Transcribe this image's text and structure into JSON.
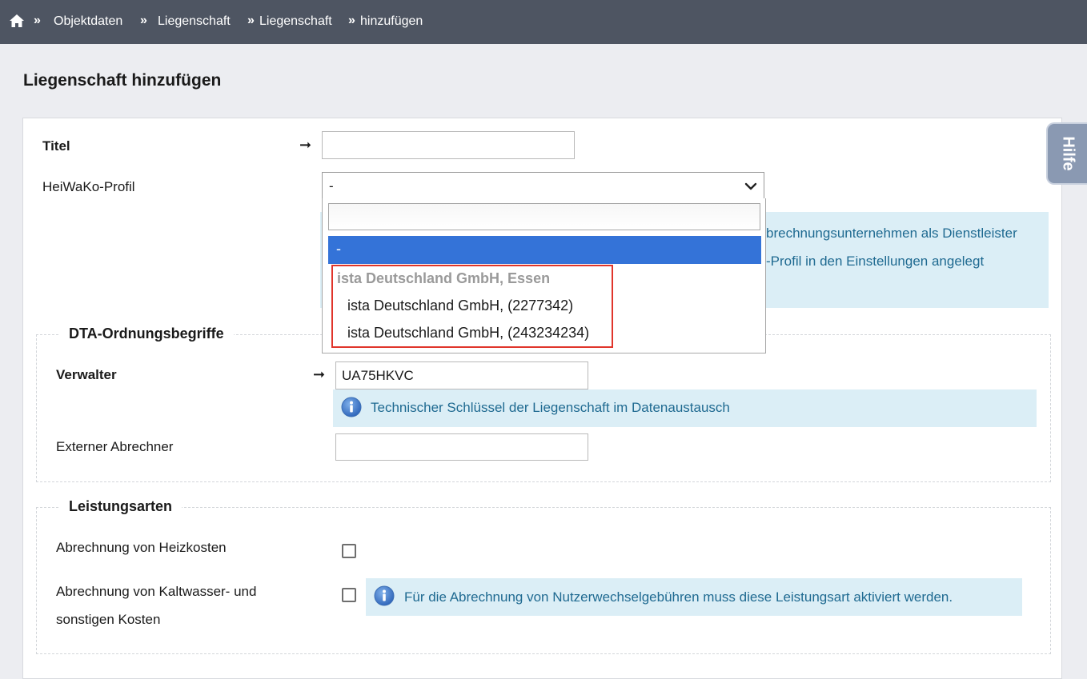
{
  "breadcrumb": {
    "home_icon": "home-icon",
    "separator": "»",
    "items": [
      "Objektdaten",
      "Liegenschaft",
      "Liegenschaft",
      "hinzufügen"
    ]
  },
  "page": {
    "title": "Liegenschaft hinzufügen"
  },
  "hilfe_tab": {
    "label": "Hilfe"
  },
  "form": {
    "titel": {
      "label": "Titel",
      "value": "",
      "required_arrow": "➞"
    },
    "heiwako": {
      "label": "HeiWaKo-Profil",
      "selected": "-",
      "info_line1": "brechnungsunternehmen als Dienstleister",
      "info_line2": "-Profil in den Einstellungen angelegt",
      "dropdown": {
        "search_value": "",
        "selected_option": "-",
        "group_label": "ista Deutschland GmbH, Essen",
        "options": [
          "ista Deutschland GmbH, (2277342)",
          "ista Deutschland GmbH, (243234234)"
        ]
      }
    }
  },
  "dta": {
    "legend": "DTA-Ordnungsbegriffe",
    "verwalter": {
      "label": "Verwalter",
      "value": "UA75HKVC",
      "required_arrow": "➞"
    },
    "info": "Technischer Schlüssel der Liegenschaft im Datenaustausch",
    "externer": {
      "label": "Externer Abrechner",
      "value": ""
    }
  },
  "leistungsarten": {
    "legend": "Leistungsarten",
    "heizkosten": {
      "label": "Abrechnung von Heizkosten",
      "checked": false
    },
    "kaltwasser": {
      "label_line1": "Abrechnung von Kaltwasser- und",
      "label_line2": "sonstigen Kosten",
      "checked": false
    },
    "info": "Für die Abrechnung von Nutzerwechselgebühren muss diese Leistungsart aktiviert werden."
  },
  "colors": {
    "topbar": "#4e5562",
    "info_bg": "#dbeef6",
    "info_text": "#1f6a91",
    "dropdown_selected": "#3473d8",
    "highlight_border": "#e0352b"
  }
}
